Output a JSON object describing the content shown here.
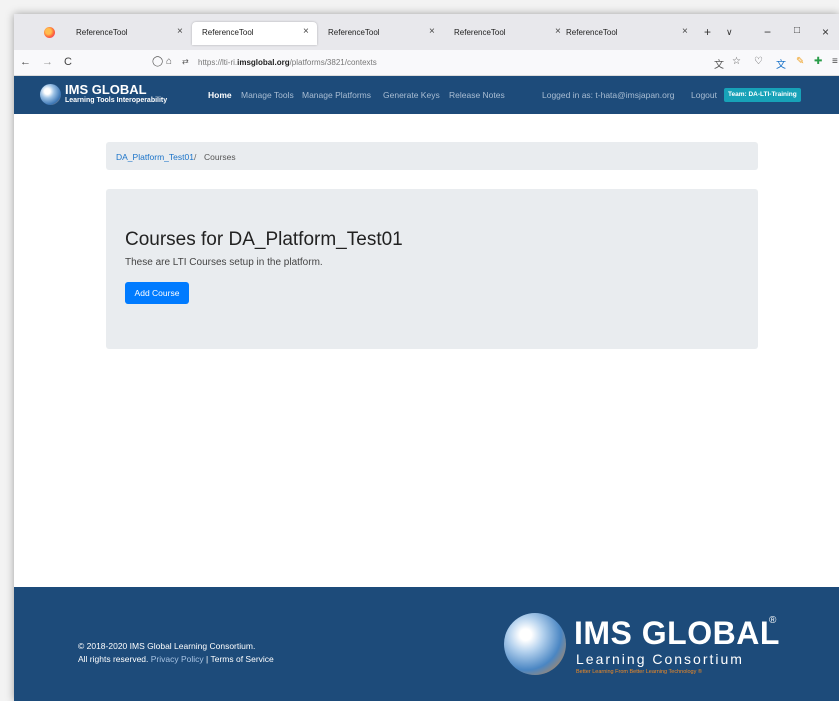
{
  "browser": {
    "tabs": [
      {
        "title": "ReferenceTool",
        "close": "×"
      },
      {
        "title": "ReferenceTool",
        "close": "×"
      },
      {
        "title": "ReferenceTool",
        "close": "×"
      },
      {
        "title": "ReferenceTool",
        "close": "×"
      },
      {
        "title": "ReferenceTool",
        "close": "×"
      }
    ],
    "new_tab": "+",
    "tab_list": "∨",
    "minimize": "−",
    "maximize": "□",
    "close": "×",
    "back": "←",
    "forward": "→",
    "reload": "C",
    "url_prefix": "https://lti-ri.",
    "url_domain": "imsglobal.org",
    "url_path": "/platforms/3821/contexts"
  },
  "header": {
    "brand_title": "IMS GLOBAL",
    "brand_subtitle": "Learning Tools Interoperability",
    "nav": [
      "Home",
      "Manage Tools",
      "Manage Platforms",
      "Generate Keys",
      "Release Notes"
    ],
    "logged_in": "Logged in as: t-hata@imsjapan.org",
    "logout": "Logout",
    "team": "Team: DA-LTI-Training"
  },
  "breadcrumb": {
    "platform": "DA_Platform_Test01",
    "separator": "/",
    "current": "Courses"
  },
  "main": {
    "title": "Courses for DA_Platform_Test01",
    "subtitle": "These are LTI Courses setup in the platform.",
    "add_button": "Add Course"
  },
  "footer": {
    "copyright": "© 2018-2020 IMS Global Learning Consortium.",
    "rights": "All rights reserved.",
    "privacy": "Privacy Policy",
    "separator": "|",
    "terms": "Terms of Service",
    "logo_title": "IMS GLOBAL",
    "logo_reg": "®",
    "logo_consortium": "Learning Consortium",
    "logo_tagline": "Better Learning From Better Learning Technology ®"
  }
}
